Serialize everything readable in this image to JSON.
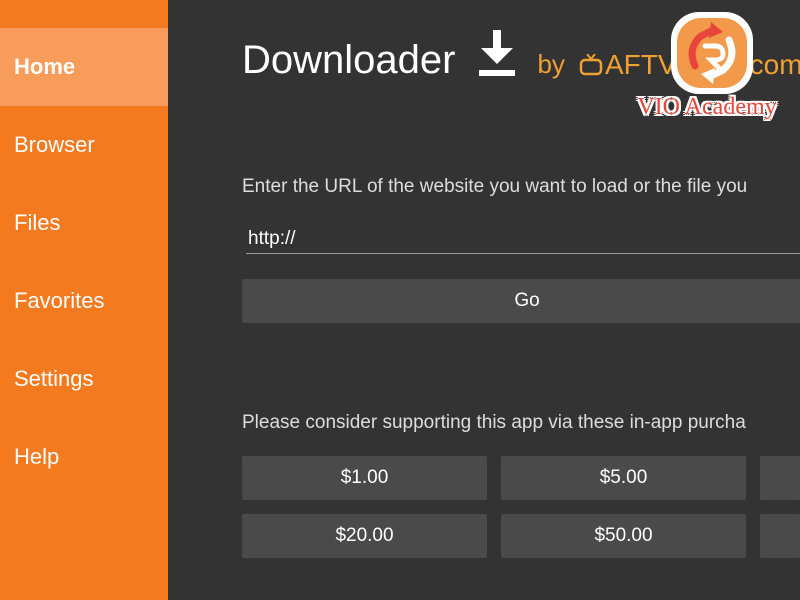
{
  "sidebar": {
    "items": [
      {
        "label": "Home",
        "active": true
      },
      {
        "label": "Browser",
        "active": false
      },
      {
        "label": "Files",
        "active": false
      },
      {
        "label": "Favorites",
        "active": false
      },
      {
        "label": "Settings",
        "active": false
      },
      {
        "label": "Help",
        "active": false
      }
    ],
    "color": "#f47a20",
    "active_color": "#f79c5a"
  },
  "header": {
    "title": "Downloader",
    "icon": "download-icon",
    "by": "by",
    "brand_icon": "tv-icon",
    "brand": "AFTVnews.com"
  },
  "url_section": {
    "prompt": "Enter the URL of the website you want to load or the file you",
    "input_value": "http://",
    "go_label": "Go"
  },
  "support_section": {
    "text": "Please consider supporting this app via these in-app purcha",
    "donations_row1": [
      "$1.00",
      "$5.00"
    ],
    "donations_row2": [
      "$20.00",
      "$50.00"
    ]
  },
  "watermark": {
    "text": "VIO Academy"
  },
  "colors": {
    "background": "#333333",
    "button": "#4a4a4a",
    "brand_orange": "#f0a030"
  }
}
